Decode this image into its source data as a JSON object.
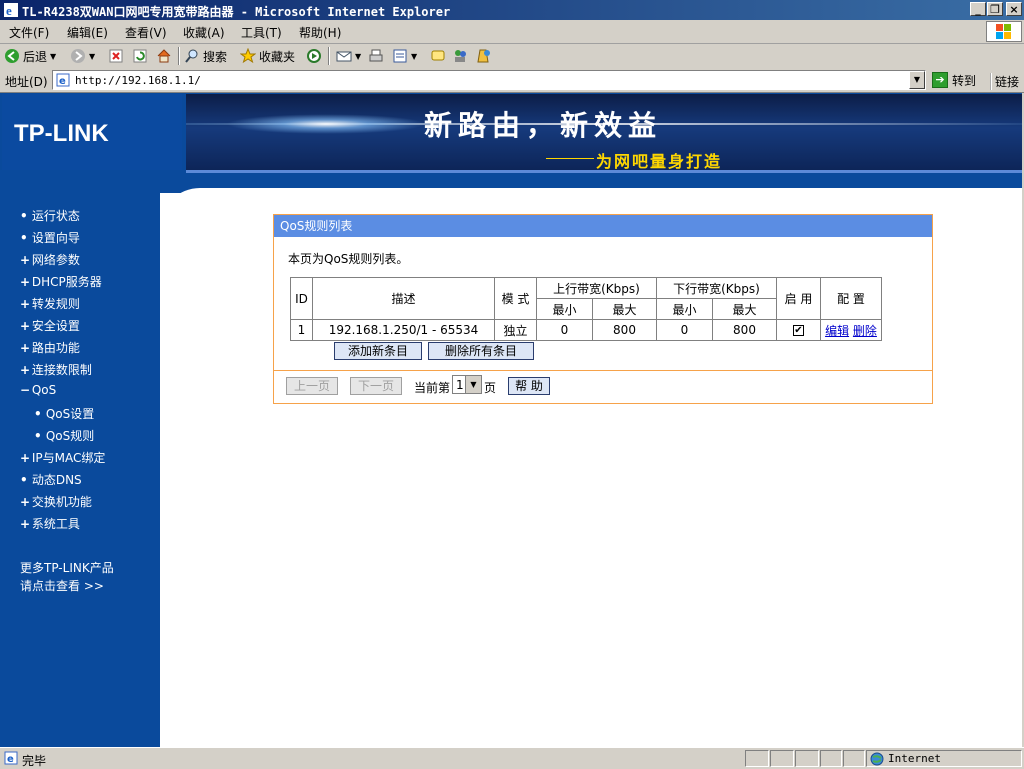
{
  "window": {
    "title": "TL-R4238双WAN口网吧专用宽带路由器 - Microsoft Internet Explorer",
    "controls": [
      "_",
      "❐",
      "×"
    ]
  },
  "menu": [
    "文件(F)",
    "编辑(E)",
    "查看(V)",
    "收藏(A)",
    "工具(T)",
    "帮助(H)"
  ],
  "toolbar": {
    "back": "后退",
    "search": "搜索",
    "favorites": "收藏夹"
  },
  "address": {
    "label": "地址(D)",
    "url": "http://192.168.1.1/",
    "go": "转到",
    "links": "链接"
  },
  "header": {
    "logo": "TP-LINK",
    "slogan": "新路由，新效益",
    "sub": "为网吧量身打造"
  },
  "nav": [
    {
      "label": "运行状态",
      "bullet": "•"
    },
    {
      "label": "设置向导",
      "bullet": "•"
    },
    {
      "label": "网络参数",
      "bullet": "+"
    },
    {
      "label": "DHCP服务器",
      "bullet": "+"
    },
    {
      "label": "转发规则",
      "bullet": "+"
    },
    {
      "label": "安全设置",
      "bullet": "+"
    },
    {
      "label": "路由功能",
      "bullet": "+"
    },
    {
      "label": "连接数限制",
      "bullet": "+"
    },
    {
      "label": "QoS",
      "bullet": "−"
    },
    {
      "label": "QoS设置",
      "bullet": "•"
    },
    {
      "label": "QoS规则",
      "bullet": "•"
    },
    {
      "label": "IP与MAC绑定",
      "bullet": "+"
    },
    {
      "label": "动态DNS",
      "bullet": "•"
    },
    {
      "label": "交换机功能",
      "bullet": "+"
    },
    {
      "label": "系统工具",
      "bullet": "+"
    }
  ],
  "more": {
    "line1": "更多TP-LINK产品",
    "line2": "请点击查看 >>"
  },
  "panel": {
    "title": "QoS规则列表",
    "description": "本页为QoS规则列表。",
    "table": {
      "headers": {
        "id": "ID",
        "desc": "描述",
        "mode": "模 式",
        "up": "上行带宽(Kbps)",
        "down": "下行带宽(Kbps)",
        "enable": "启 用",
        "config": "配 置",
        "min": "最小",
        "max": "最大"
      },
      "rows": [
        {
          "id": "1",
          "desc": "192.168.1.250/1 - 65534",
          "mode": "独立",
          "up_min": "0",
          "up_max": "800",
          "down_min": "0",
          "down_max": "800",
          "enabled": "✔",
          "edit": "编辑",
          "delete": "删除"
        }
      ]
    },
    "buttons": {
      "add": "添加新条目",
      "delete_all": "删除所有条目"
    },
    "pager": {
      "prev": "上一页",
      "next": "下一页",
      "current_prefix": "当前第",
      "page_value": "1",
      "page_suffix": "页",
      "help": "帮 助"
    }
  },
  "status": {
    "done": "完毕",
    "zone": "Internet"
  }
}
